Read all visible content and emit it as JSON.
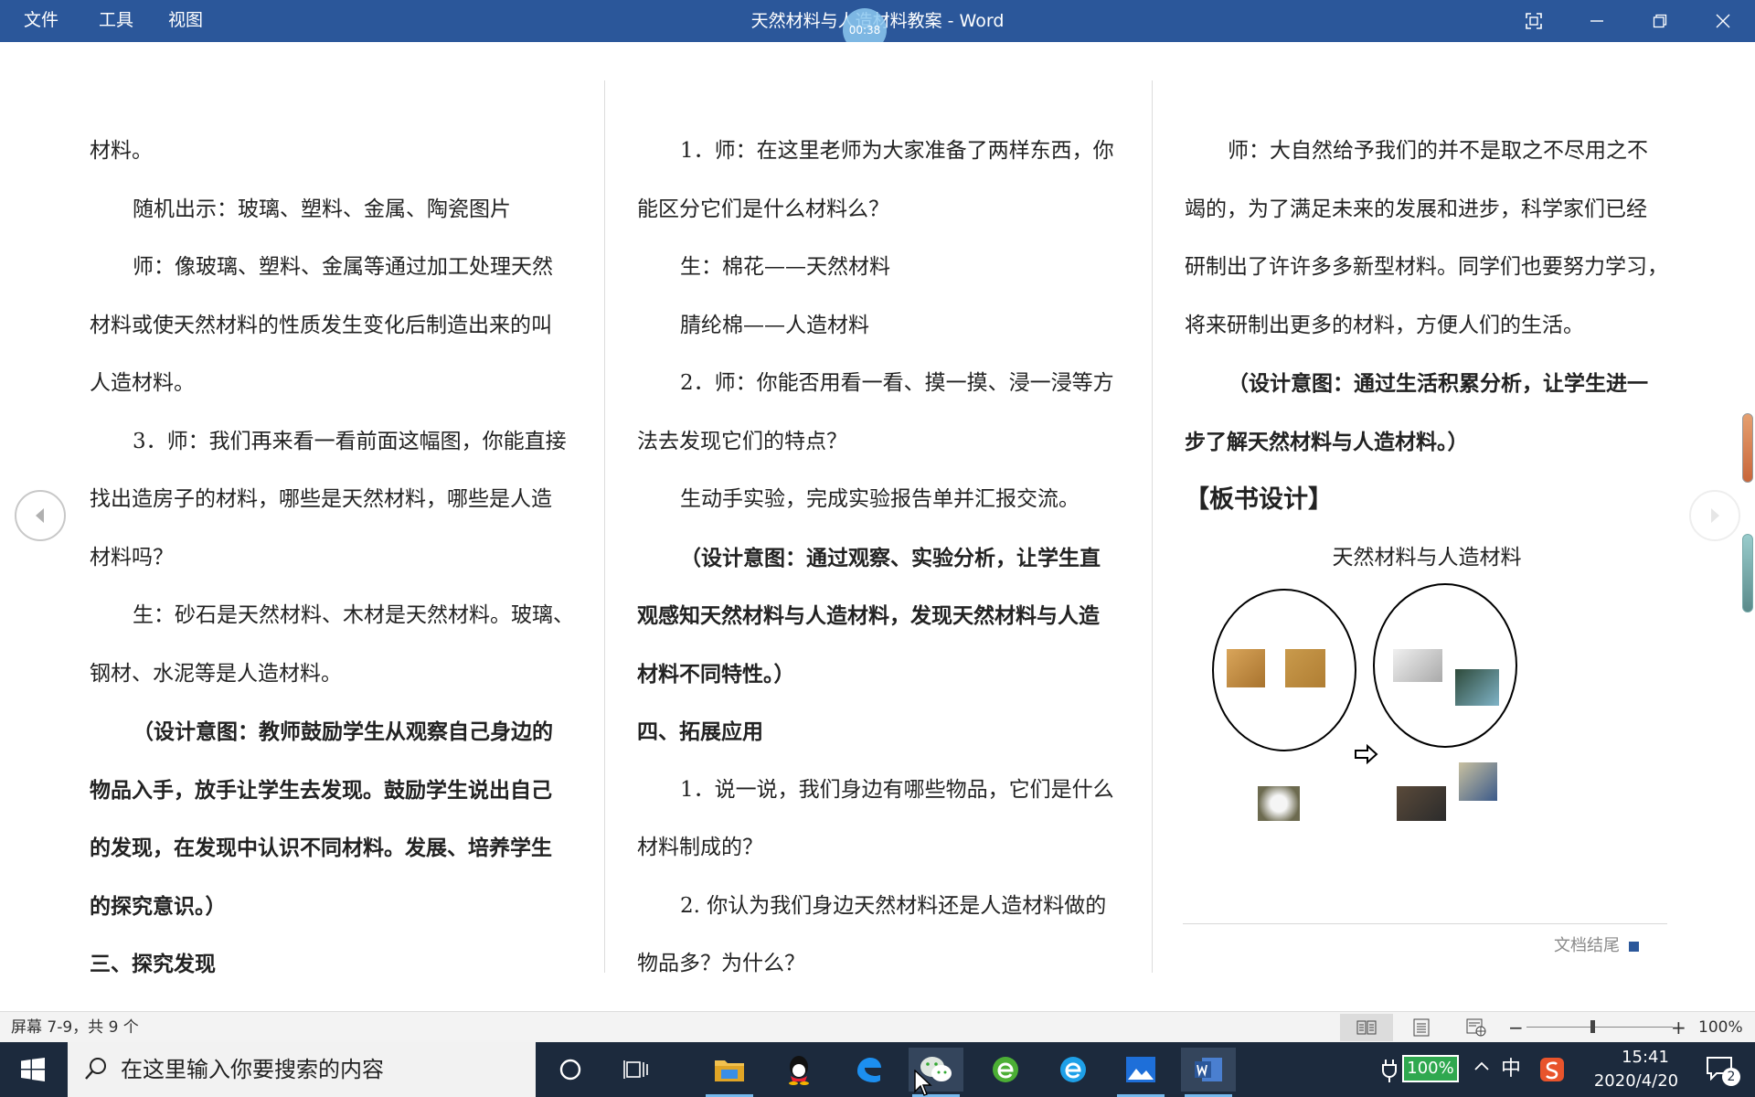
{
  "titlebar": {
    "menu_file": "文件",
    "menu_tools": "工具",
    "menu_view": "视图",
    "title": "天然材料与人造材料教案 - Word",
    "recording_time": "00:38",
    "color": "#2b579a"
  },
  "columns": {
    "left": [
      {
        "text": "材料。",
        "style": "plain"
      },
      {
        "text": "随机出示：玻璃、塑料、金属、陶瓷图片",
        "style": "indent"
      },
      {
        "text": "师：像玻璃、塑料、金属等通过加工处理天然",
        "style": "indent"
      },
      {
        "text": "材料或使天然材料的性质发生变化后制造出来的叫",
        "style": "plain"
      },
      {
        "text": "人造材料。",
        "style": "plain"
      },
      {
        "text": "3．师：我们再来看一看前面这幅图，你能直接",
        "style": "indent"
      },
      {
        "text": "找出造房子的材料，哪些是天然材料，哪些是人造",
        "style": "plain"
      },
      {
        "text": "材料吗？",
        "style": "plain"
      },
      {
        "text": "生：砂石是天然材料、木材是天然材料。玻璃、",
        "style": "indent"
      },
      {
        "text": "钢材、水泥等是人造材料。",
        "style": "plain"
      },
      {
        "text": "（设计意图：教师鼓励学生从观察自己身边的",
        "style": "indent-bold"
      },
      {
        "text": "物品入手，放手让学生去发现。鼓励学生说出自己",
        "style": "bold"
      },
      {
        "text": "的发现，在发现中认识不同材料。发展、培养学生",
        "style": "bold"
      },
      {
        "text": "的探究意识。）",
        "style": "bold"
      },
      {
        "text": "三、探究发现",
        "style": "bold"
      }
    ],
    "middle": [
      {
        "text": "1．师：在这里老师为大家准备了两样东西，你",
        "style": "indent"
      },
      {
        "text": "能区分它们是什么材料么？",
        "style": "plain"
      },
      {
        "text": "生：棉花——天然材料",
        "style": "indent"
      },
      {
        "text": "腈纶棉——人造材料",
        "style": "indent"
      },
      {
        "text": "2．师：你能否用看一看、摸一摸、浸一浸等方",
        "style": "indent"
      },
      {
        "text": "法去发现它们的特点？",
        "style": "plain"
      },
      {
        "text": "生动手实验，完成实验报告单并汇报交流。",
        "style": "indent"
      },
      {
        "text": "（设计意图：通过观察、实验分析，让学生直",
        "style": "indent-bold"
      },
      {
        "text": "观感知天然材料与人造材料，发现天然材料与人造",
        "style": "bold"
      },
      {
        "text": "材料不同特性。）",
        "style": "bold"
      },
      {
        "text": "四、拓展应用",
        "style": "bold"
      },
      {
        "text": "1．说一说，我们身边有哪些物品，它们是什么",
        "style": "indent"
      },
      {
        "text": "材料制成的？",
        "style": "plain"
      },
      {
        "text": "2. 你认为我们身边天然材料还是人造材料做的",
        "style": "indent"
      },
      {
        "text": "物品多？为什么？",
        "style": "plain"
      }
    ],
    "right": [
      {
        "text": "师：大自然给予我们的并不是取之不尽用之不",
        "style": "indent"
      },
      {
        "text": "竭的，为了满足未来的发展和进步，科学家们已经",
        "style": "plain"
      },
      {
        "text": "研制出了许许多多新型材料。同学们也要努力学习，",
        "style": "plain"
      },
      {
        "text": "将来研制出更多的材料，方便人们的生活。",
        "style": "plain"
      },
      {
        "text": "（设计意图：通过生活积累分析，让学生进一",
        "style": "indent-bold"
      },
      {
        "text": "步了解天然材料与人造材料。）",
        "style": "bold"
      },
      {
        "text": "【板书设计】",
        "style": "heading"
      },
      {
        "text": "天然材料与人造材料",
        "style": "center"
      }
    ]
  },
  "doc_end": "文档结尾",
  "statusbar": {
    "screen_info": "屏幕 7-9，共 9 个",
    "zoom_minus": "−",
    "zoom_plus": "+",
    "zoom_level": "100%",
    "zoom_fraction": 0.0
  },
  "taskbar": {
    "search_placeholder": "在这里输入你要搜索的内容",
    "battery": "100%",
    "ime": "中",
    "time": "15:41",
    "date": "2020/4/20",
    "notifications": "2"
  }
}
